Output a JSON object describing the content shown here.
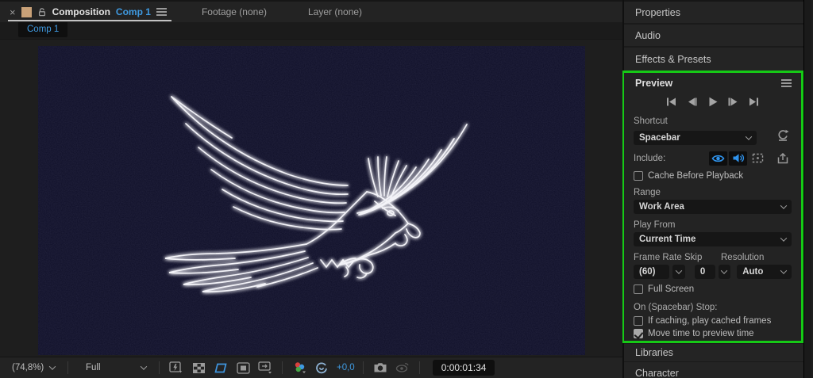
{
  "viewer": {
    "tab_composition": {
      "close": "×",
      "name": "Composition",
      "target": "Comp 1"
    },
    "tab_footage": "Footage (none)",
    "tab_layer": "Layer (none)",
    "subtab": "Comp 1"
  },
  "toolbar": {
    "zoom": "(74,8%)",
    "resolution": "Full",
    "exposure_value": "+0,0",
    "timecode": "0:00:01:34"
  },
  "panels": {
    "properties": "Properties",
    "audio": "Audio",
    "effects_presets": "Effects & Presets",
    "libraries": "Libraries",
    "character": "Character"
  },
  "preview": {
    "title": "Preview",
    "shortcut_label": "Shortcut",
    "shortcut_value": "Spacebar",
    "include_label": "Include:",
    "include_states": {
      "video": true,
      "audio": true,
      "overlays": false
    },
    "cache_label": "Cache Before Playback",
    "cache_checked": false,
    "range_label": "Range",
    "range_value": "Work Area",
    "play_from_label": "Play From",
    "play_from_value": "Current Time",
    "frame_rate_label": "Frame Rate",
    "frame_rate_value": "(60)",
    "skip_label": "Skip",
    "skip_value": "0",
    "resolution_label": "Resolution",
    "resolution_value": "Auto",
    "full_screen_label": "Full Screen",
    "full_screen_checked": false,
    "on_stop_label": "On (Spacebar) Stop:",
    "if_caching_label": "If caching, play cached frames",
    "if_caching_checked": false,
    "move_time_label": "Move time to preview time",
    "move_time_checked": true
  },
  "colors": {
    "accent_blue": "#3f9ae1",
    "highlight_green": "#16c916",
    "viewport_navy": "#0f0f28",
    "roi_active_blue": "#3f96e0"
  }
}
